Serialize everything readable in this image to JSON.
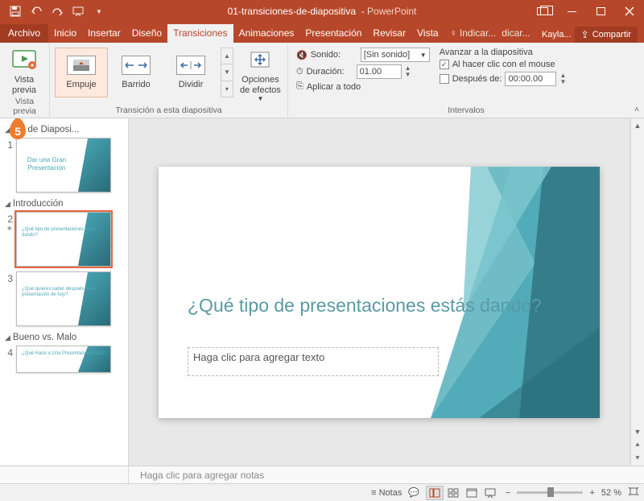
{
  "titlebar": {
    "filename": "01-transiciones-de-diapositiva",
    "app": "PowerPoint"
  },
  "tabs": {
    "file": "Archivo",
    "home": "Inicio",
    "insert": "Insertar",
    "design": "Diseño",
    "transitions": "Transiciones",
    "animations": "Animaciones",
    "slideshow": "Presentación",
    "review": "Revisar",
    "view": "Vista",
    "tellme": "Indicar...",
    "tellme2": "dicar...",
    "user": "Kayla...",
    "share": "Compartir"
  },
  "ribbon": {
    "preview": {
      "label": "Vista previa",
      "group": "Vista previa"
    },
    "gallery": {
      "items": [
        {
          "name": "Empuje"
        },
        {
          "name": "Barrido"
        },
        {
          "name": "Dividir"
        }
      ],
      "effects": "Opciones de efectos",
      "group": "Transición a esta diapositiva"
    },
    "timing": {
      "sound_lbl": "Sonido:",
      "sound_val": "[Sin sonido]",
      "duration_lbl": "Duración:",
      "duration_val": "01.00",
      "applyall": "Aplicar a todo",
      "group": "Intervalos"
    },
    "advance": {
      "title": "Avanzar a la diapositiva",
      "onclick": "Al hacer clic con el mouse",
      "after": "Después de:",
      "after_val": "00:00.00"
    }
  },
  "thumbnails": {
    "sections": [
      {
        "name": "ulo de Diaposi...",
        "slides": [
          {
            "num": "1",
            "title": "Dar una Gran Presentación"
          }
        ]
      },
      {
        "name": "Introducción",
        "slides": [
          {
            "num": "2",
            "title": "¿Qué tipo de presentaciones estás dando?",
            "selected": true,
            "star": true
          },
          {
            "num": "3",
            "title": "¿Qué quieres saber después de la presentación de hoy?"
          }
        ]
      },
      {
        "name": "Bueno vs. Malo",
        "slides": [
          {
            "num": "4",
            "title": "¿Qué Hace a Una Presentación Mala?"
          }
        ]
      }
    ]
  },
  "slide": {
    "title": "¿Qué tipo de presentaciones estás dando?",
    "body_placeholder": "Haga clic para agregar texto"
  },
  "notes": {
    "placeholder": "Haga clic para agregar notas"
  },
  "status": {
    "notes": "Notas",
    "zoom": "52 %"
  },
  "callout": {
    "num": "5"
  }
}
